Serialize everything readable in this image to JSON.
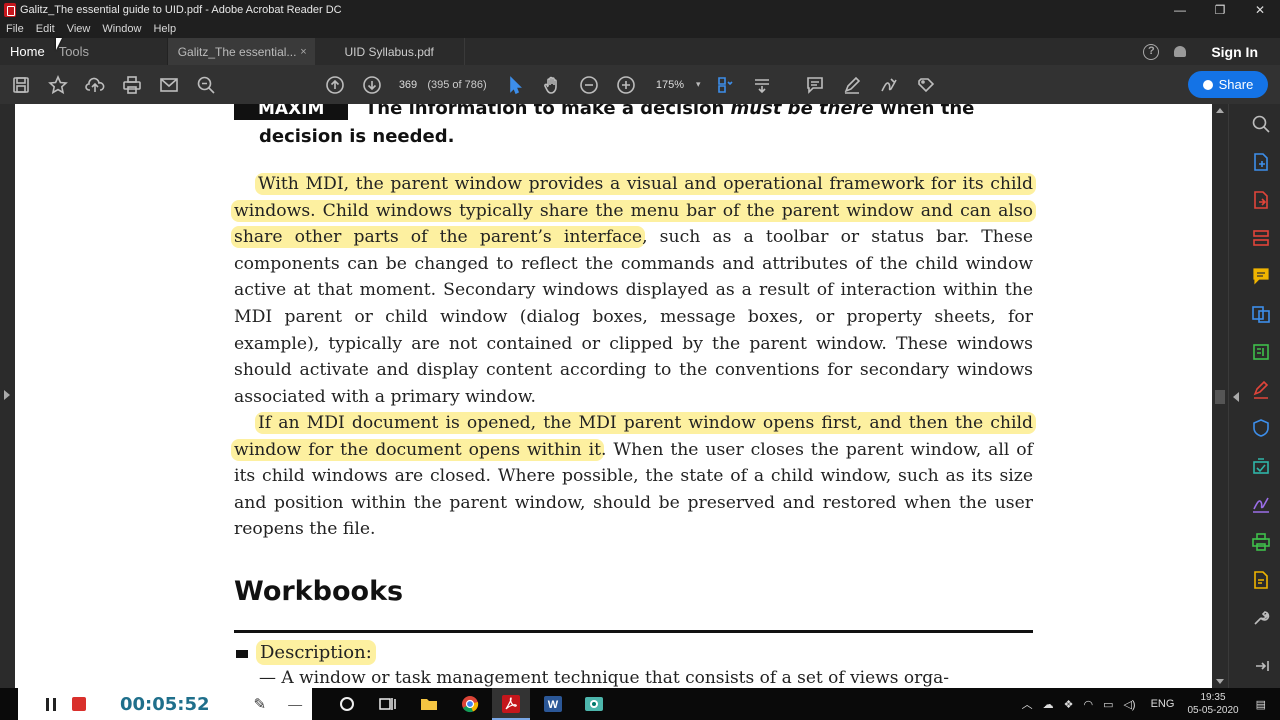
{
  "window": {
    "title": "Galitz_The essential guide to UID.pdf - Adobe Acrobat Reader DC",
    "controls": {
      "minimize": "—",
      "maximize": "❐",
      "close": "✕"
    }
  },
  "menu": [
    "File",
    "Edit",
    "View",
    "Window",
    "Help"
  ],
  "tabs": {
    "home": "Home",
    "tools": "Tools",
    "doc_active": "Galitz_The essential...",
    "doc_active_close": "×",
    "doc_other": "UID Syllabus.pdf"
  },
  "header_right": {
    "help": "?",
    "signin": "Sign In"
  },
  "toolbar": {
    "page_current": "369",
    "page_count": "(395 of 786)",
    "zoom": "175%",
    "dropdown": "▾",
    "share": "Share"
  },
  "document": {
    "maxim_label": "MAXIM",
    "maxim_text_before": "The information to make a decision ",
    "maxim_text_italic": "must be there",
    "maxim_text_after": " when the",
    "maxim_cont": "decision is needed.",
    "p1_highlight": "With MDI, the parent window provides a visual and operational framework for its child windows. Child windows typically share the menu bar of the parent window and can also share other parts of the parent’s interface",
    "p1_rest": ", such as a toolbar or status bar. These components can be changed to reflect the commands and attributes of the child window active at that moment. Secondary windows displayed as a result of interaction within the MDI parent or child window (dialog boxes, message boxes, or property sheets, for example), typically are not contained or clipped by the parent window. These windows should activate and display content according to the conventions for secondary windows associated with a primary window.",
    "p2_highlight": "If an MDI document is opened, the MDI parent window opens first, and then the child window for the document opens within it",
    "p2_rest": ". When the user closes the parent window, all of its child windows are closed. Where possible, the state of a child window, such as its size and position within the parent window, should be preserved and restored when the user reopens the file.",
    "heading": "Workbooks",
    "bullet_label": "Description:",
    "bullet_text": "— A window or task management technique that consists of a set of views orga-"
  },
  "recorder": {
    "time": "00:05:52",
    "minimize": "—"
  },
  "systray": {
    "lang": "ENG",
    "time": "19:35",
    "date": "05-05-2020"
  },
  "colors": {
    "highlight": "#fdf0a0",
    "accent": "#1473e6",
    "rec_time": "#1f6f8b"
  }
}
